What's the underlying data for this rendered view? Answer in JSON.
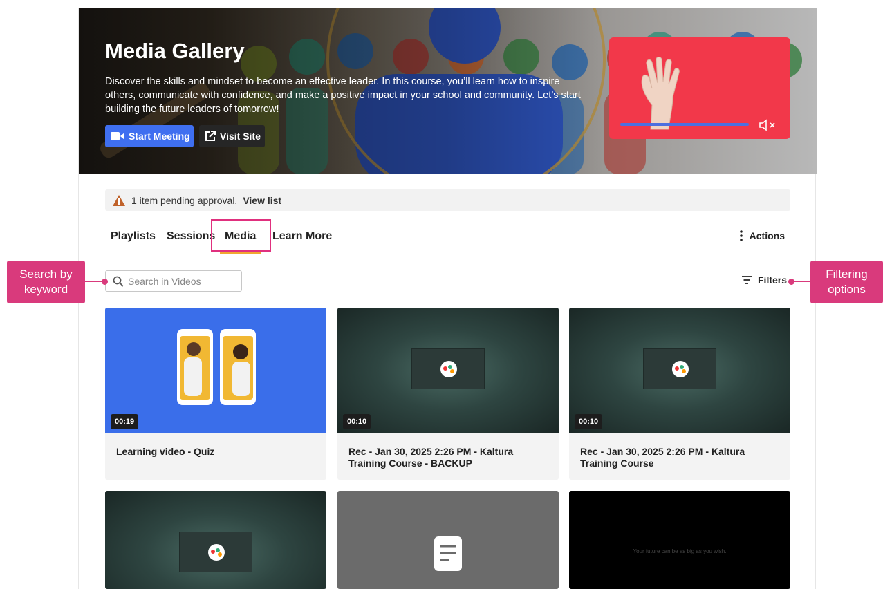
{
  "hero": {
    "title": "Media Gallery",
    "description": "Discover the skills and mindset to become an effective leader. In this course, you’ll learn how to inspire others, communicate with confidence, and make a positive impact in your school and community. Let’s start building the future leaders of tomorrow!",
    "start_meeting_label": "Start Meeting",
    "visit_site_label": "Visit Site"
  },
  "notice": {
    "text": "1 item pending approval.",
    "link": "View list"
  },
  "tabs": [
    {
      "label": "Playlists"
    },
    {
      "label": "Sessions"
    },
    {
      "label": "Media"
    },
    {
      "label": "Learn More"
    }
  ],
  "active_tab": "Media",
  "actions_label": "Actions",
  "search": {
    "placeholder": "Search in Videos"
  },
  "filters_label": "Filters",
  "cards": [
    {
      "duration": "00:19",
      "title": "Learning video - Quiz"
    },
    {
      "duration": "00:10",
      "title": "Rec - Jan 30, 2025 2:26 PM - Kaltura Training Course - BACKUP"
    },
    {
      "duration": "00:10",
      "title": "Rec - Jan 30, 2025 2:26 PM - Kaltura Training Course"
    },
    {
      "duration": "",
      "title": ""
    },
    {
      "duration": "",
      "title": ""
    },
    {
      "duration": "",
      "title": "",
      "thumb_text": "Your future can be as big as you wish."
    }
  ],
  "callouts": {
    "search": "Search by keyword",
    "filters": "Filtering options"
  },
  "colors": {
    "accent": "#3f6ff0",
    "callout": "#d93a7c",
    "tab_underline": "#f0a830",
    "video_bg": "#f2384a"
  }
}
